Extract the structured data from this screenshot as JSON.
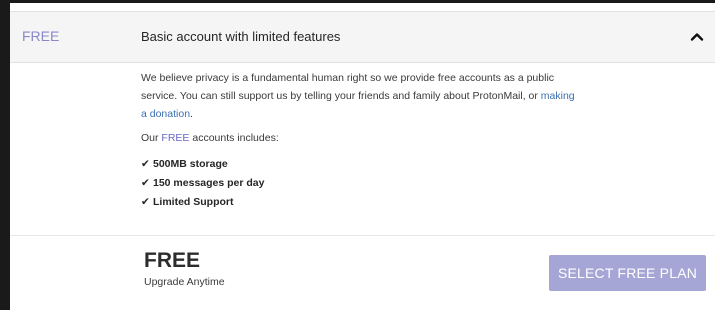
{
  "plan": {
    "name": "FREE",
    "description": "Basic account with limited features",
    "chevron_icon": "chevron-up-icon"
  },
  "details": {
    "paragraph_text": "We believe privacy is a fundamental human right so we provide free accounts as a public service. You can still support us by telling your friends and family about ProtonMail, or ",
    "donation_link": "making a donation",
    "paragraph_end": ".",
    "includes_prefix": "Our ",
    "includes_highlight": "FREE",
    "includes_suffix": " accounts includes:",
    "check_icon": "check-icon",
    "features": [
      "500MB storage",
      "150 messages per day",
      "Limited Support"
    ]
  },
  "footer": {
    "title": "FREE",
    "subtitle": "Upgrade Anytime",
    "select_button": "SELECT FREE PLAN"
  },
  "colors": {
    "accent": "#8a88c9",
    "link": "#3b6fb0",
    "button_bg": "#a6a6d6",
    "header_bg": "#f5f5f5"
  }
}
